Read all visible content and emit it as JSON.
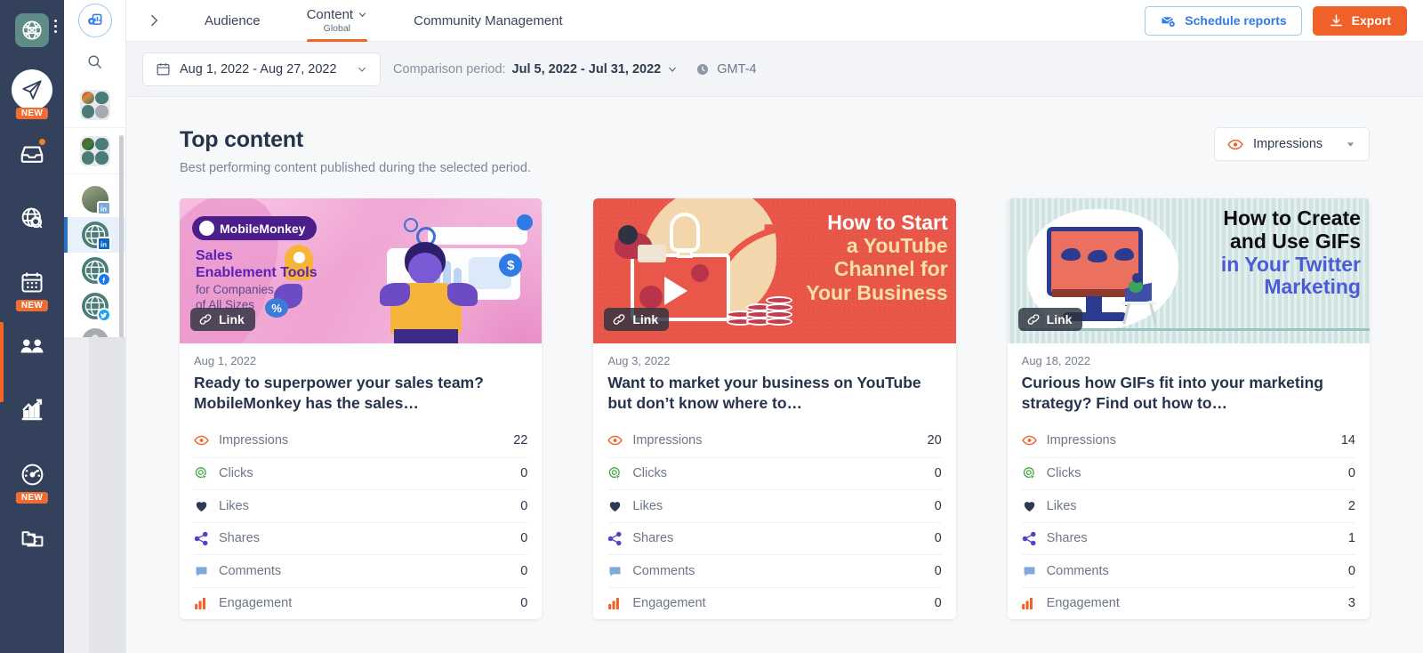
{
  "rail": {
    "items": [
      {
        "name": "logo",
        "icon": "globe-logo-icon",
        "badge": ""
      },
      {
        "name": "publish",
        "icon": "paper-plane-icon",
        "badge": "NEW"
      },
      {
        "name": "inbox",
        "icon": "inbox-icon",
        "badge": ""
      },
      {
        "name": "listening",
        "icon": "globe-search-icon",
        "badge": ""
      },
      {
        "name": "calendar",
        "icon": "calendar-icon",
        "badge": "NEW"
      },
      {
        "name": "audience",
        "icon": "people-icon",
        "badge": ""
      },
      {
        "name": "analytics",
        "icon": "growth-chart-icon",
        "badge": ""
      },
      {
        "name": "benchmark",
        "icon": "speedometer-icon",
        "badge": "NEW"
      },
      {
        "name": "media-library",
        "icon": "media-folder-icon",
        "badge": ""
      }
    ]
  },
  "subrail": {
    "add_label": "add-profile",
    "search_label": "search",
    "accounts": [
      {
        "name": "group-1",
        "type": "group"
      },
      {
        "name": "group-2",
        "type": "group"
      },
      {
        "name": "linkedin-personal",
        "network": "linkedin",
        "selected": false
      },
      {
        "name": "linkedin-company",
        "network": "linkedin",
        "selected": true
      },
      {
        "name": "facebook-page",
        "network": "facebook",
        "selected": false
      },
      {
        "name": "twitter-profile",
        "network": "twitter",
        "selected": false
      },
      {
        "name": "instagram-profile",
        "network": "instagram",
        "selected": false
      }
    ]
  },
  "topbar": {
    "collapse_icon": "chevron-right-icon",
    "tabs": [
      {
        "label": "Audience",
        "sub": "",
        "active": false,
        "caret": false
      },
      {
        "label": "Content",
        "sub": "Global",
        "active": true,
        "caret": true
      },
      {
        "label": "Community Management",
        "sub": "",
        "active": false,
        "caret": false
      }
    ],
    "schedule_reports_label": "Schedule reports",
    "export_label": "Export"
  },
  "filterbar": {
    "date_range": "Aug 1, 2022 - Aug 27, 2022",
    "comparison_prefix": "Comparison period:",
    "comparison_value": "Jul 5, 2022 - Jul 31, 2022",
    "timezone": "GMT-4"
  },
  "section": {
    "title": "Top content",
    "subtitle": "Best performing content published during the selected period.",
    "metric_selected": "Impressions"
  },
  "link_badge_label": "Link",
  "metric_labels": {
    "impressions": "Impressions",
    "clicks": "Clicks",
    "likes": "Likes",
    "shares": "Shares",
    "comments": "Comments",
    "engagement": "Engagement"
  },
  "cards": [
    {
      "date": "Aug 1, 2022",
      "title": "Ready to superpower your sales team? MobileMonkey has the sales…",
      "artwork": {
        "brand": "MobileMonkey",
        "line1": "Sales",
        "line2": "Enablement Tools",
        "line3": "for Companies",
        "line4": "of All Sizes"
      },
      "metrics": [
        {
          "label": "Impressions",
          "value": "22"
        },
        {
          "label": "Clicks",
          "value": "0"
        },
        {
          "label": "Likes",
          "value": "0"
        },
        {
          "label": "Shares",
          "value": "0"
        },
        {
          "label": "Comments",
          "value": "0"
        },
        {
          "label": "Engagement",
          "value": "0"
        }
      ]
    },
    {
      "date": "Aug 3, 2022",
      "title": "Want to market your business on YouTube but don’t know where to…",
      "artwork": {
        "line1": "How to Start",
        "line2": "a YouTube",
        "line3": "Channel for",
        "line4": "Your Business"
      },
      "metrics": [
        {
          "label": "Impressions",
          "value": "20"
        },
        {
          "label": "Clicks",
          "value": "0"
        },
        {
          "label": "Likes",
          "value": "0"
        },
        {
          "label": "Shares",
          "value": "0"
        },
        {
          "label": "Comments",
          "value": "0"
        },
        {
          "label": "Engagement",
          "value": "0"
        }
      ]
    },
    {
      "date": "Aug 18, 2022",
      "title": "Curious how GIFs fit into your marketing strategy? Find out how to…",
      "artwork": {
        "line1": "How to Create",
        "line2": "and Use GIFs",
        "line3": "in Your Twitter",
        "line4": "Marketing"
      },
      "metrics": [
        {
          "label": "Impressions",
          "value": "14"
        },
        {
          "label": "Clicks",
          "value": "0"
        },
        {
          "label": "Likes",
          "value": "2"
        },
        {
          "label": "Shares",
          "value": "1"
        },
        {
          "label": "Comments",
          "value": "0"
        },
        {
          "label": "Engagement",
          "value": "3"
        }
      ]
    }
  ],
  "colors": {
    "rail_bg": "#33415c",
    "accent_orange": "#ef6128",
    "link_blue": "#2f7ae5",
    "heading": "#26334d"
  }
}
